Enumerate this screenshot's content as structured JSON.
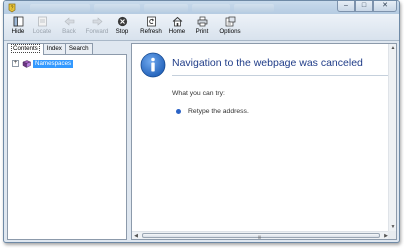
{
  "toolbar": {
    "buttons": [
      {
        "label": "Hide",
        "icon": "hide-icon",
        "enabled": true
      },
      {
        "label": "Locate",
        "icon": "locate-icon",
        "enabled": false
      },
      {
        "label": "Back",
        "icon": "back-arrow-icon",
        "enabled": false
      },
      {
        "label": "Forward",
        "icon": "forward-arrow-icon",
        "enabled": false
      },
      {
        "label": "Stop",
        "icon": "stop-icon",
        "enabled": true
      },
      {
        "label": "Refresh",
        "icon": "refresh-icon",
        "enabled": true
      },
      {
        "label": "Home",
        "icon": "home-icon",
        "enabled": true
      },
      {
        "label": "Print",
        "icon": "print-icon",
        "enabled": true
      },
      {
        "label": "Options",
        "icon": "options-icon",
        "enabled": true
      }
    ]
  },
  "tabs": [
    {
      "label": "Contents",
      "active": true
    },
    {
      "label": "Index",
      "active": false
    },
    {
      "label": "Search",
      "active": false
    }
  ],
  "tree": {
    "items": [
      {
        "label": "Namespaces",
        "expander": "+",
        "icon": "book-icon",
        "selected": true
      }
    ]
  },
  "content": {
    "title": "Navigation to the webpage was canceled",
    "prompt": "What you can try:",
    "suggestions": [
      "Retype the address."
    ]
  },
  "colors": {
    "title_blue": "#1f3c88",
    "selection_blue": "#3399ff",
    "bullet_blue": "#2b63c6",
    "info_icon_blue": "#1f5fb8"
  }
}
